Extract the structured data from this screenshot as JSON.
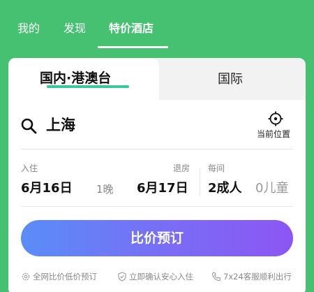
{
  "topnav": {
    "tabs": [
      "我的",
      "发现",
      "特价酒店"
    ],
    "active_tab": "特价酒店"
  },
  "region_tabs": {
    "domestic": "国内·港澳台",
    "international": "国际"
  },
  "search": {
    "city": "上海",
    "locate_label": "当前位置"
  },
  "dates": {
    "checkin_label": "入住",
    "checkin_value": "6月16日",
    "nights": "1晚",
    "checkout_label": "退房",
    "checkout_value": "6月17日",
    "room_label": "每间",
    "adults": "2成人",
    "kids": "0儿童"
  },
  "book_button": "比价预订",
  "features": [
    {
      "icon": "gear-icon",
      "text": "全网比价低价预订"
    },
    {
      "icon": "shield-check-icon",
      "text": "立即确认安心入住"
    },
    {
      "icon": "phone-icon",
      "text": "7x24客服顺利出行"
    }
  ],
  "colors": {
    "brand_green": "#46c171",
    "tab_mark": "#3ec79a",
    "button_gradient_start": "#5a8df7",
    "button_gradient_end": "#8c56f4"
  }
}
